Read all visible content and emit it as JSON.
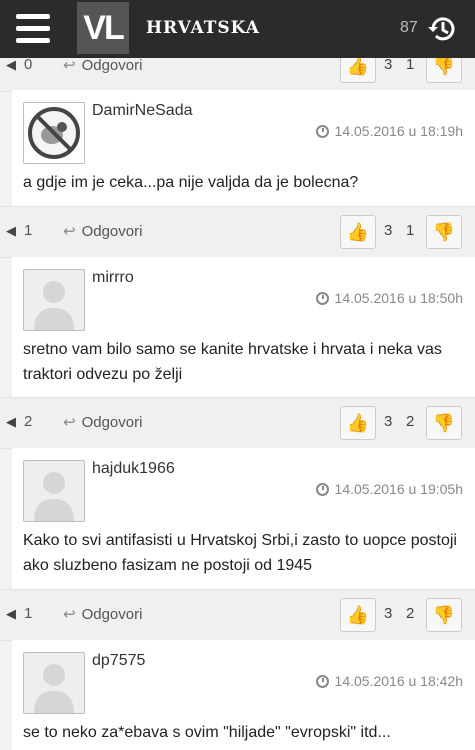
{
  "header": {
    "logo": "VL",
    "section": "HRVATSKA",
    "history_count": "87"
  },
  "top_actions": {
    "reply_count": "0",
    "reply_label": "Odgovori",
    "likes": "3",
    "dislikes": "1"
  },
  "comments": [
    {
      "author": "DamirNeSada",
      "time": "14.05.2016 u 18:19h",
      "text": "a gdje im je ceka...pa nije valjda da je bolecna?",
      "replies": "1",
      "reply_label": "Odgovori",
      "likes": "3",
      "dislikes": "1"
    },
    {
      "author": "mirrro",
      "time": "14.05.2016 u 18:50h",
      "text": "sretno vam bilo samo se kanite hrvatske i hrvata i neka vas traktori odvezu po želji",
      "replies": "2",
      "reply_label": "Odgovori",
      "likes": "3",
      "dislikes": "2"
    },
    {
      "author": "hajduk1966",
      "time": "14.05.2016 u 19:05h",
      "text": "Kako to svi antifasisti u Hrvatskoj Srbi,i zasto to uopce postoji ako sluzbeno fasizam ne postoji od 1945",
      "replies": "1",
      "reply_label": "Odgovori",
      "likes": "3",
      "dislikes": "2"
    },
    {
      "author": "dp7575",
      "time": "14.05.2016 u 18:42h",
      "text": "se to neko za*ebava s ovim \"hiljade\" \"evropski\" itd..."
    }
  ]
}
